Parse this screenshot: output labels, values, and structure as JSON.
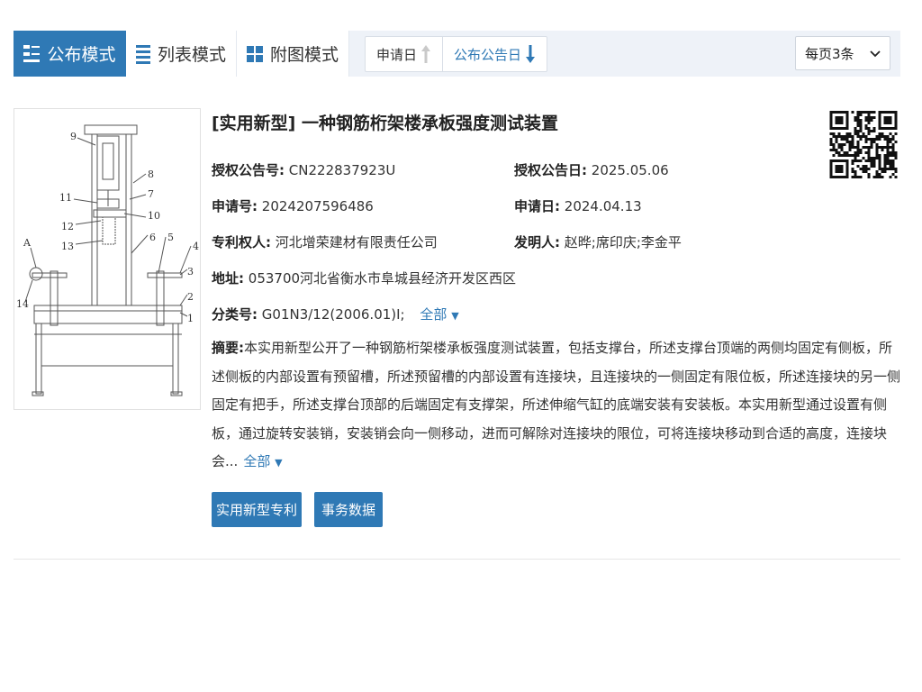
{
  "view_modes": [
    {
      "label": "公布模式",
      "icon": "publish-mode-icon",
      "active": true
    },
    {
      "label": "列表模式",
      "icon": "list-mode-icon",
      "active": false
    },
    {
      "label": "附图模式",
      "icon": "grid-mode-icon",
      "active": false
    }
  ],
  "sort": {
    "application_date": "申请日",
    "publication_date": "公布公告日"
  },
  "per_page": {
    "selected": "每页3条"
  },
  "result": {
    "title": "[实用新型] 一种钢筋桁架楼承板强度测试装置",
    "grant_no_label": "授权公告号:",
    "grant_no": "CN222837923U",
    "grant_date_label": "授权公告日:",
    "grant_date": "2025.05.06",
    "app_no_label": "申请号:",
    "app_no": "2024207596486",
    "app_date_label": "申请日:",
    "app_date": "2024.04.13",
    "patentee_label": "专利权人:",
    "patentee": "河北增荣建材有限责任公司",
    "inventor_label": "发明人:",
    "inventor": "赵晔;席印庆;李金平",
    "address_label": "地址:",
    "address": "053700河北省衡水市阜城县经济开发区西区",
    "class_label": "分类号:",
    "class_no": "G01N3/12(2006.01)I;",
    "more_label": "全部",
    "abstract_label": "摘要:",
    "abstract_text": "本实用新型公开了一种钢筋桁架楼承板强度测试装置，包括支撑台，所述支撑台顶端的两侧均固定有侧板，所述侧板的内部设置有预留槽，所述预留槽的内部设置有连接块，且连接块的一侧固定有限位板，所述连接块的另一侧固定有把手，所述支撑台顶部的后端固定有支撑架，所述伸缩气缸的底端安装有安装板。本实用新型通过设置有侧板，通过旋转安装销，安装销会向一侧移动，进而可解除对连接块的限位，可将连接块移动到合适的高度，连接块会...",
    "buttons": [
      "实用新型专利",
      "事务数据"
    ],
    "drawing_labels": [
      "9",
      "8",
      "7",
      "11",
      "10",
      "12",
      "13",
      "6",
      "5",
      "4",
      "3",
      "2",
      "1",
      "A",
      "14"
    ]
  },
  "colors": {
    "accent": "#2f79b5",
    "toolbar_bg": "#eef2f8"
  }
}
